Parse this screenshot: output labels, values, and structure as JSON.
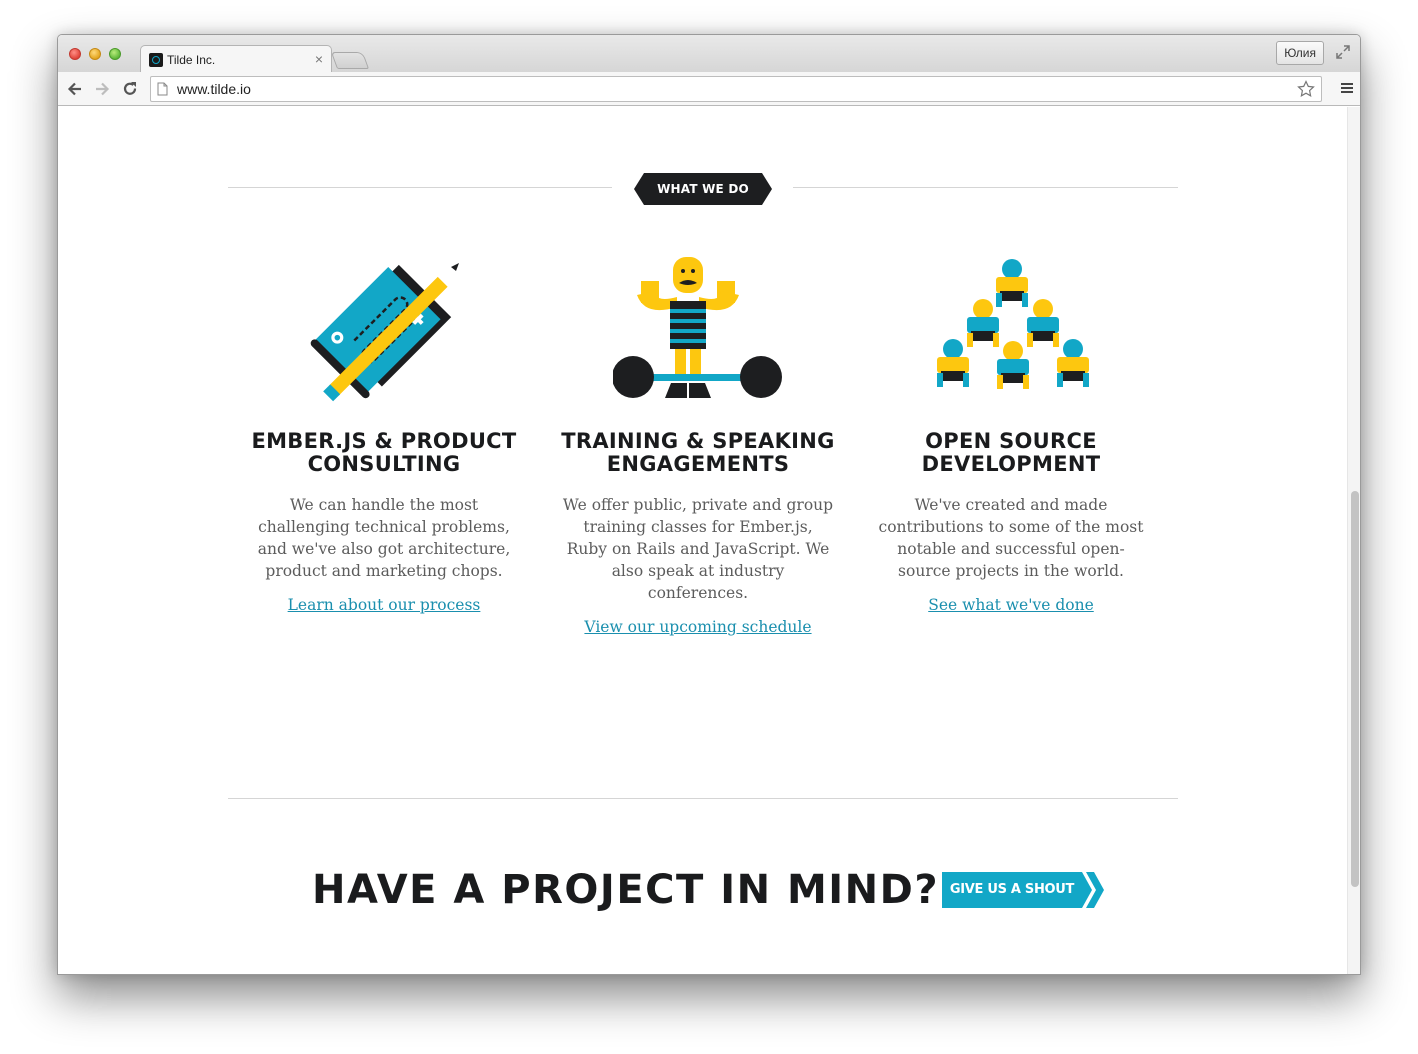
{
  "browser": {
    "tab_title": "Tilde Inc.",
    "tab_close": "×",
    "profile_name": "Юлия",
    "url": "www.tilde.io"
  },
  "page": {
    "section_badge": "WHAT WE DO",
    "services": [
      {
        "icon": "blueprint-pencil-icon",
        "title_line1": "EMBER.JS & PRODUCT",
        "title_line2": "CONSULTING",
        "description": "We can handle the most challenging technical problems, and we've also got architecture, product and marketing chops.",
        "link": "Learn about our process"
      },
      {
        "icon": "strongman-icon",
        "title_line1": "TRAINING & SPEAKING",
        "title_line2": "ENGAGEMENTS",
        "description": "We offer public, private and group training classes for Ember.js, Ruby on Rails and JavaScript. We also speak at industry conferences.",
        "link": "View our upcoming schedule"
      },
      {
        "icon": "human-pyramid-icon",
        "title_line1": "OPEN SOURCE",
        "title_line2": "DEVELOPMENT",
        "description": "We've created and made contributions to some of the most notable and successful open-source projects in the world.",
        "link": "See what we've done"
      }
    ],
    "cta_title": "HAVE A PROJECT IN MIND?",
    "cta_button": "GIVE US A SHOUT"
  },
  "colors": {
    "accent_teal": "#12a7c7",
    "accent_yellow": "#fdc70f",
    "dark": "#1d1e20",
    "link": "#1a8fae"
  }
}
